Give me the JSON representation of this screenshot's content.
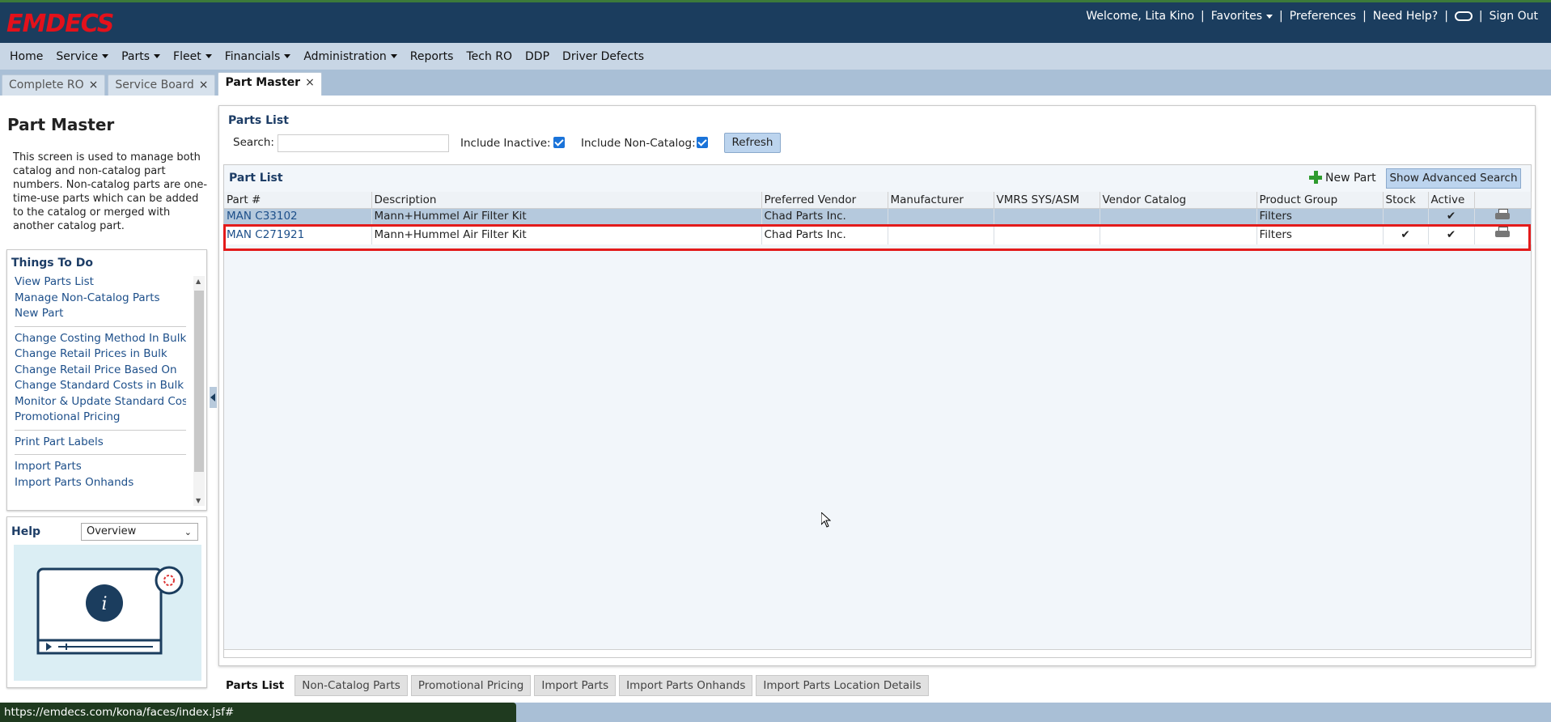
{
  "header": {
    "logo": "EMDECS",
    "welcome": "Welcome, Lita Kino",
    "favorites": "Favorites",
    "preferences": "Preferences",
    "need_help": "Need Help?",
    "sign_out": "Sign Out",
    "separator": "|"
  },
  "nav": {
    "items": [
      {
        "label": "Home",
        "caret": false
      },
      {
        "label": "Service",
        "caret": true
      },
      {
        "label": "Parts",
        "caret": true
      },
      {
        "label": "Fleet",
        "caret": true
      },
      {
        "label": "Financials",
        "caret": true
      },
      {
        "label": "Administration",
        "caret": true
      },
      {
        "label": "Reports",
        "caret": false
      },
      {
        "label": "Tech RO",
        "caret": false
      },
      {
        "label": "DDP",
        "caret": false
      },
      {
        "label": "Driver Defects",
        "caret": false
      }
    ]
  },
  "page_tabs": [
    {
      "label": "Complete RO",
      "active": false,
      "close": "×"
    },
    {
      "label": "Service Board",
      "active": false,
      "close": "×"
    },
    {
      "label": "Part Master",
      "active": true,
      "close": "×"
    }
  ],
  "left": {
    "title": "Part Master",
    "description": "This screen is used to manage both catalog and non-catalog part numbers. Non-catalog parts are one-time-use parts which can be added to the catalog or merged with another catalog part.",
    "things_to_do_title": "Things To Do",
    "todo_groups": [
      [
        "View Parts List",
        "Manage Non-Catalog Parts",
        "New Part"
      ],
      [
        "Change Costing Method In Bulk",
        "Change Retail Prices in Bulk",
        "Change Retail Price Based On",
        "Change Standard Costs in Bulk",
        "Monitor & Update Standard Costs",
        "Promotional Pricing"
      ],
      [
        "Print Part Labels"
      ],
      [
        "Import Parts",
        "Import Parts Onhands"
      ]
    ],
    "help_title": "Help",
    "help_selected": "Overview"
  },
  "main": {
    "parts_list_heading": "Parts List",
    "search_label": "Search:",
    "search_value": "",
    "include_inactive_label": "Include Inactive:",
    "include_inactive": true,
    "include_noncatalog_label": "Include Non-Catalog:",
    "include_noncatalog": true,
    "refresh_label": "Refresh",
    "grid_title": "Part List",
    "new_part_label": "New Part",
    "advanced_search_label": "Show Advanced Search",
    "columns": [
      "Part #",
      "Description",
      "Preferred Vendor",
      "Manufacturer",
      "VMRS SYS/ASM",
      "Vendor Catalog",
      "Product Group",
      "Stock",
      "Active",
      ""
    ],
    "rows": [
      {
        "part": "MAN C33102",
        "description": "Mann+Hummel Air Filter Kit",
        "vendor": "Chad Parts Inc.",
        "manufacturer": "",
        "vmrs": "",
        "vendor_catalog": "",
        "product_group": "Filters",
        "stock": "",
        "active": "✔"
      },
      {
        "part": "MAN C271921",
        "description": "Mann+Hummel Air Filter Kit",
        "vendor": "Chad Parts Inc.",
        "manufacturer": "",
        "vmrs": "",
        "vendor_catalog": "",
        "product_group": "Filters",
        "stock": "✔",
        "active": "✔"
      }
    ]
  },
  "bottom_tabs": [
    {
      "label": "Parts List",
      "active": true
    },
    {
      "label": "Non-Catalog Parts",
      "active": false
    },
    {
      "label": "Promotional Pricing",
      "active": false
    },
    {
      "label": "Import Parts",
      "active": false
    },
    {
      "label": "Import Parts Onhands",
      "active": false
    },
    {
      "label": "Import Parts Location Details",
      "active": false
    }
  ],
  "status": {
    "url": "https://emdecs.com/kona/faces/index.jsf#"
  },
  "colors": {
    "header_bg": "#1b3d5e",
    "logo": "#e3111b",
    "link": "#1d4f8a",
    "highlight": "#e31b1b"
  }
}
